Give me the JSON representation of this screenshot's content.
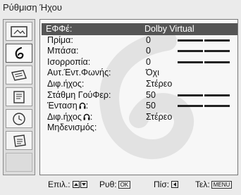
{
  "window": {
    "title": "Ρύθμιση Ήχου"
  },
  "sidebar": {
    "items": [
      {
        "icon": "picture-icon"
      },
      {
        "icon": "sound-icon",
        "active": true
      },
      {
        "icon": "screen-icon"
      },
      {
        "icon": "features-icon"
      },
      {
        "icon": "timer-icon"
      },
      {
        "icon": "setup-icon"
      }
    ]
  },
  "settings": {
    "rows": [
      {
        "label": "ΕΦΦέ:",
        "value": "Dolby Virtual",
        "selected": true
      },
      {
        "label": "Πρίμα:",
        "value": "0",
        "slider": 0.5
      },
      {
        "label": "Μπάσα:",
        "value": "0",
        "slider": 0.5
      },
      {
        "label": "Ισορροπία:",
        "value": "0",
        "slider": 0.5
      },
      {
        "label": "Αυτ.Έντ.Φωνής:",
        "value": "Όχι"
      },
      {
        "label": "Διφ.ήχος:",
        "value": "Στέρεο"
      },
      {
        "label": "Στάθμη ΓούΦερ:",
        "value": "50",
        "slider": 0.5
      },
      {
        "label": "Ένταση",
        "label_suffix": ":",
        "headphone_icon": true,
        "value": "50",
        "slider": 0.5
      },
      {
        "label": "Διφ.ήχος",
        "label_suffix": ":",
        "headphone_icon": true,
        "value": "Στέρεο"
      },
      {
        "label": "Μηδενισμός:",
        "value": ""
      }
    ]
  },
  "footer": {
    "select_label": "Επιλ.:",
    "set_label": "Ρυθ:",
    "set_key": "OK",
    "back_label": "Πίσ:",
    "exit_label": "Τελ:",
    "exit_key": "MENU"
  }
}
